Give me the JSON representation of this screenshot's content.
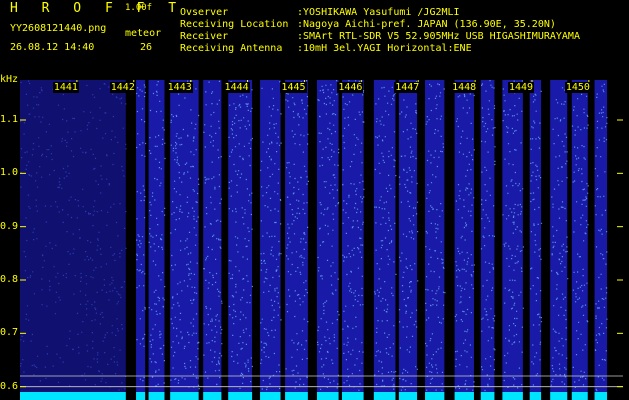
{
  "header": {
    "brand": "H R O F F T",
    "version": "1.00f",
    "filename": "YY2608121440.png",
    "datetime": "26.08.12 14:40",
    "meteor_label": "meteor",
    "meteor_count": "26"
  },
  "info": [
    {
      "key": "Ovserver",
      "value": ":YOSHIKAWA Yasufumi /JG2MLI"
    },
    {
      "key": "Receiving Location",
      "value": ":Nagoya Aichi-pref. JAPAN (136.90E, 35.20N)"
    },
    {
      "key": "Receiver",
      "value": ":SMArt RTL-SDR V5 52.905MHz USB HIGASHIMURAYAMA"
    },
    {
      "key": "Receiving Antenna",
      "value": ":10mH 3el.YAGI Horizontal:ENE"
    }
  ],
  "colors": {
    "text": "#ffff00",
    "spectrum": "#1a1aa8",
    "bright": "#6fb8ff",
    "baseline": "#00e5ff"
  },
  "chart_data": {
    "type": "heatmap",
    "title": "",
    "ylabel": "kHz",
    "xlabel": "",
    "ylim": [
      0.575,
      1.175
    ],
    "y_ticks": [
      "1.1",
      "1.0",
      "0.9",
      "0.8",
      "0.7",
      "0.6"
    ],
    "x_ticks": [
      "1441",
      "1442",
      "1443",
      "1444",
      "1445",
      "1446",
      "1447",
      "1448",
      "1449",
      "1450"
    ],
    "minute_start": 1440,
    "minute_end": 1450.6,
    "reference_lines_khz": [
      0.62,
      0.6
    ],
    "active_segments_min": [
      [
        1440.0,
        1441.86
      ],
      [
        1442.04,
        1442.2
      ],
      [
        1442.26,
        1442.54
      ],
      [
        1442.64,
        1443.14
      ],
      [
        1443.22,
        1443.54
      ],
      [
        1443.66,
        1444.08
      ],
      [
        1444.22,
        1444.58
      ],
      [
        1444.66,
        1445.06
      ],
      [
        1445.22,
        1445.6
      ],
      [
        1445.66,
        1446.04
      ],
      [
        1446.22,
        1446.6
      ],
      [
        1446.66,
        1446.98
      ],
      [
        1447.12,
        1447.46
      ],
      [
        1447.64,
        1447.98
      ],
      [
        1448.1,
        1448.34
      ],
      [
        1448.48,
        1448.84
      ],
      [
        1448.96,
        1449.16
      ],
      [
        1449.32,
        1449.62
      ],
      [
        1449.7,
        1449.98
      ],
      [
        1450.1,
        1450.32
      ]
    ]
  }
}
